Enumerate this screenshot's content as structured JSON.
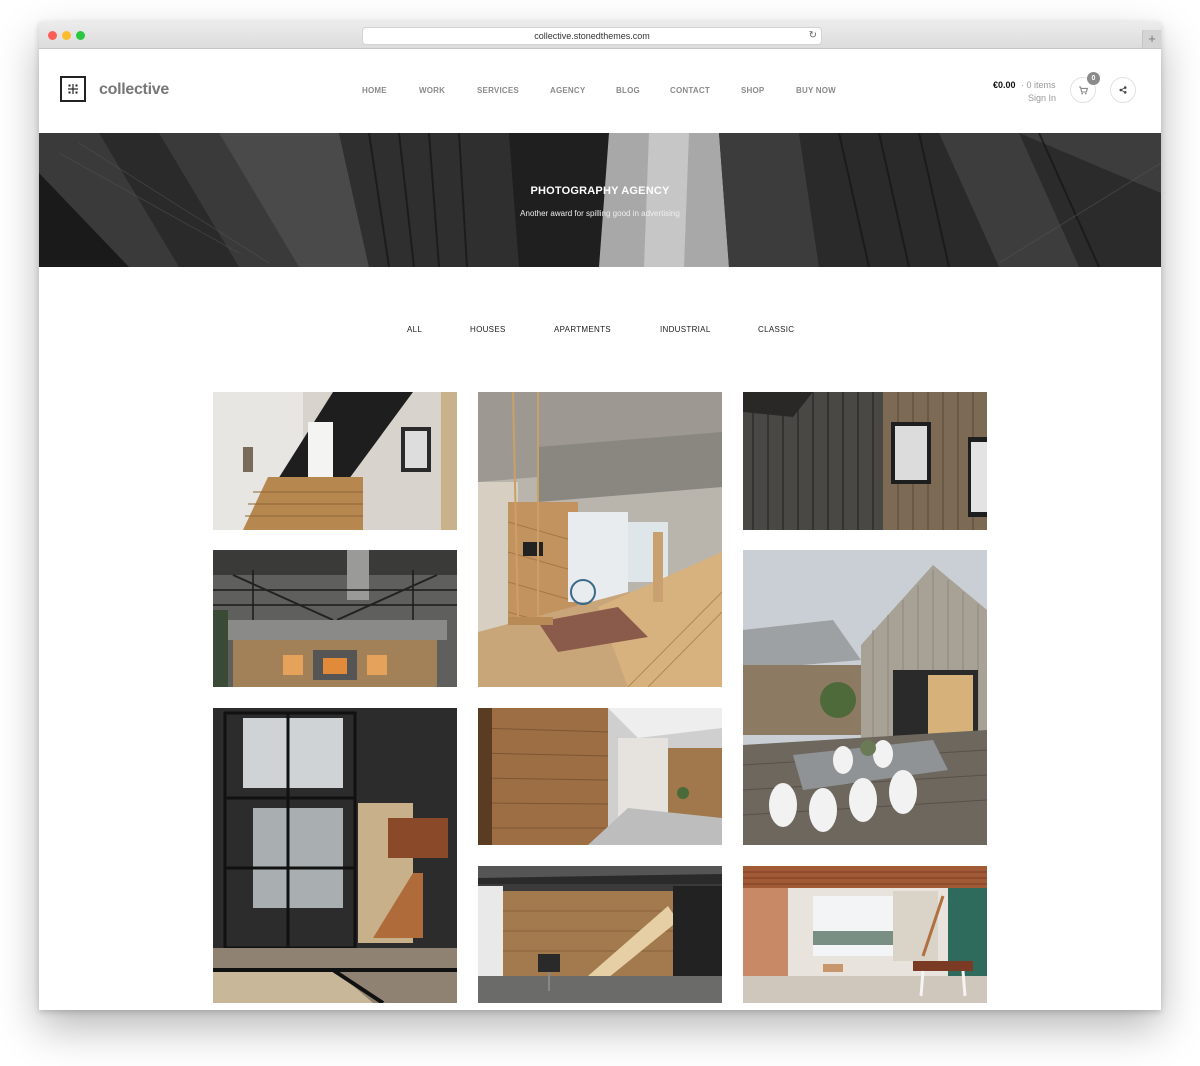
{
  "browser": {
    "url": "collective.stonedthemes.com"
  },
  "brand": {
    "name": "collective"
  },
  "nav": {
    "items": [
      "HOME",
      "WORK",
      "SERVICES",
      "AGENCY",
      "BLOG",
      "CONTACT",
      "SHOP",
      "BUY NOW"
    ]
  },
  "cart": {
    "total": "€0.00",
    "items": "· 0 items",
    "badge": "0",
    "signin": "Sign In"
  },
  "hero": {
    "title": "PHOTOGRAPHY AGENCY",
    "subtitle": "Another award for spilling good in advertising"
  },
  "filters": [
    "ALL",
    "HOUSES",
    "APARTMENTS",
    "INDUSTRIAL",
    "CLASSIC"
  ],
  "colors": {
    "traffic_red": "#fc5f57",
    "traffic_yellow": "#fdbc2e",
    "traffic_green": "#29c840",
    "nav_text": "#8a8a8a",
    "badge": "#8b8b8b"
  },
  "icons": [
    "logo-mark-icon",
    "reload-icon",
    "new-tab-icon",
    "cart-icon",
    "share-icon"
  ]
}
